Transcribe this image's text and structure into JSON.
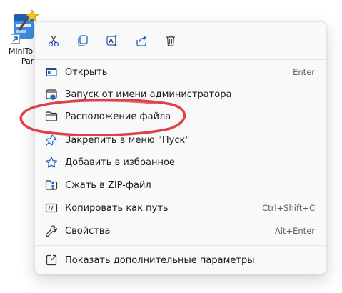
{
  "desktop_icon": {
    "label_line1": "MiniTo",
    "label_line2": "Partiti"
  },
  "toolbar": {
    "cut": "cut-icon",
    "copy": "copy-icon",
    "rename": "rename-icon",
    "share": "share-icon",
    "delete": "delete-icon"
  },
  "menu": {
    "items": [
      {
        "label": "Открыть",
        "shortcut": "Enter",
        "icon": "open-icon"
      },
      {
        "label": "Запуск от имени администратора",
        "shortcut": "",
        "icon": "run-as-admin-icon"
      },
      {
        "label": "Расположение файла",
        "shortcut": "",
        "icon": "folder-icon"
      },
      {
        "label": "Закрепить в меню \"Пуск\"",
        "shortcut": "",
        "icon": "pin-icon"
      },
      {
        "label": "Добавить в избранное",
        "shortcut": "",
        "icon": "star-icon"
      },
      {
        "label": "Сжать в ZIP-файл",
        "shortcut": "",
        "icon": "zip-icon"
      },
      {
        "label": "Копировать как путь",
        "shortcut": "Ctrl+Shift+C",
        "icon": "copy-path-icon"
      },
      {
        "label": "Свойства",
        "shortcut": "Alt+Enter",
        "icon": "wrench-icon"
      }
    ],
    "more": {
      "label": "Показать дополнительные параметры",
      "icon": "more-options-icon"
    }
  },
  "colors": {
    "accent": "#1a63c7",
    "highlight": "#e0404a",
    "menu_bg": "#f9f9f9"
  }
}
